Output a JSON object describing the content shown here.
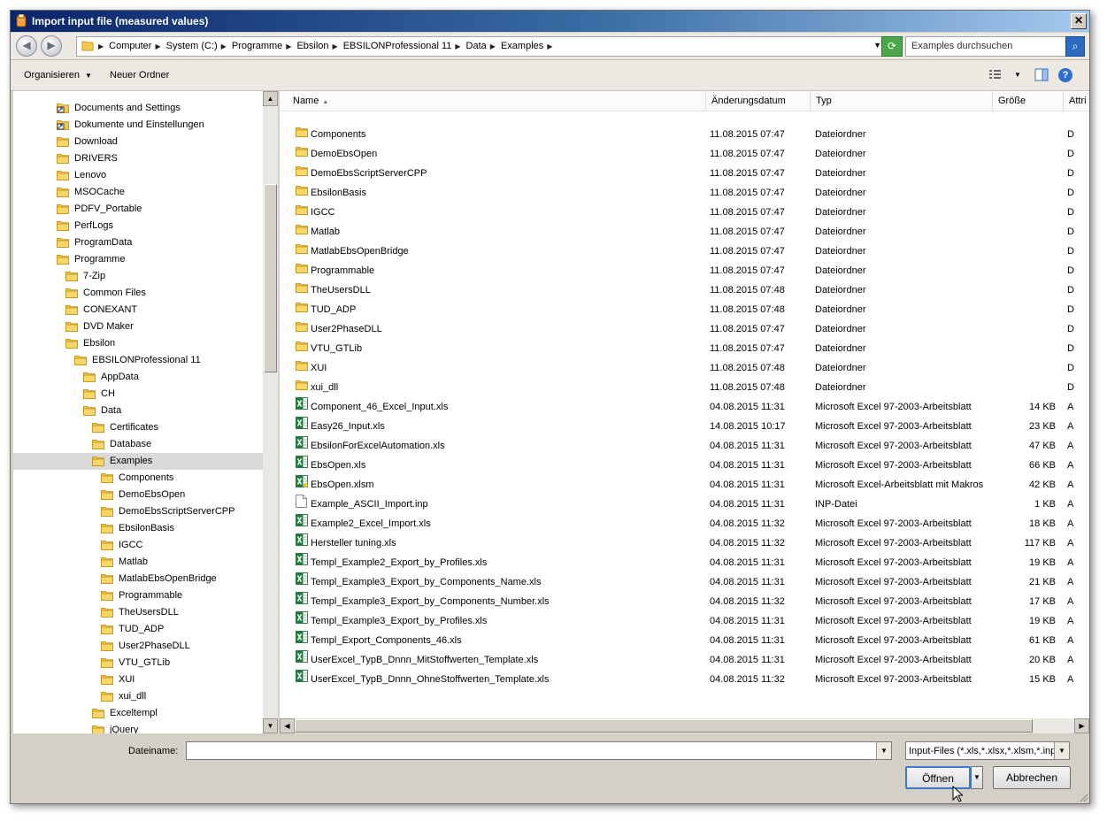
{
  "window": {
    "title": "Import input file (measured values)",
    "close_glyph": "✕"
  },
  "nav": {
    "back_icon": "◀",
    "forward_icon": "▶",
    "breadcrumbs": [
      "Computer",
      "System (C:)",
      "Programme",
      "Ebsilon",
      "EBSILONProfessional 11",
      "Data",
      "Examples"
    ],
    "search_placeholder": "Examples durchsuchen"
  },
  "toolbar": {
    "organize": "Organisieren",
    "new_folder": "Neuer Ordner"
  },
  "tree": [
    {
      "label": "Documents and Settings",
      "level": 0,
      "icon": "shortcut"
    },
    {
      "label": "Dokumente und Einstellungen",
      "level": 0,
      "icon": "shortcut"
    },
    {
      "label": "Download",
      "level": 0,
      "icon": "folder"
    },
    {
      "label": "DRIVERS",
      "level": 0,
      "icon": "folder"
    },
    {
      "label": "Lenovo",
      "level": 0,
      "icon": "folder"
    },
    {
      "label": "MSOCache",
      "level": 0,
      "icon": "folder"
    },
    {
      "label": "PDFV_Portable",
      "level": 0,
      "icon": "folder"
    },
    {
      "label": "PerfLogs",
      "level": 0,
      "icon": "folder"
    },
    {
      "label": "ProgramData",
      "level": 0,
      "icon": "folder"
    },
    {
      "label": "Programme",
      "level": 0,
      "icon": "folder"
    },
    {
      "label": "7-Zip",
      "level": 1,
      "icon": "folder"
    },
    {
      "label": "Common Files",
      "level": 1,
      "icon": "folder"
    },
    {
      "label": "CONEXANT",
      "level": 1,
      "icon": "folder"
    },
    {
      "label": "DVD Maker",
      "level": 1,
      "icon": "folder"
    },
    {
      "label": "Ebsilon",
      "level": 1,
      "icon": "folder"
    },
    {
      "label": "EBSILONProfessional 11",
      "level": 2,
      "icon": "folder"
    },
    {
      "label": "AppData",
      "level": 3,
      "icon": "folder"
    },
    {
      "label": "CH",
      "level": 3,
      "icon": "folder"
    },
    {
      "label": "Data",
      "level": 3,
      "icon": "folder"
    },
    {
      "label": "Certificates",
      "level": 4,
      "icon": "folder"
    },
    {
      "label": "Database",
      "level": 4,
      "icon": "folder"
    },
    {
      "label": "Examples",
      "level": 4,
      "icon": "folder",
      "selected": true
    },
    {
      "label": "Components",
      "level": 5,
      "icon": "folder"
    },
    {
      "label": "DemoEbsOpen",
      "level": 5,
      "icon": "folder"
    },
    {
      "label": "DemoEbsScriptServerCPP",
      "level": 5,
      "icon": "folder"
    },
    {
      "label": "EbsilonBasis",
      "level": 5,
      "icon": "folder"
    },
    {
      "label": "IGCC",
      "level": 5,
      "icon": "folder"
    },
    {
      "label": "Matlab",
      "level": 5,
      "icon": "folder"
    },
    {
      "label": "MatlabEbsOpenBridge",
      "level": 5,
      "icon": "folder"
    },
    {
      "label": "Programmable",
      "level": 5,
      "icon": "folder"
    },
    {
      "label": "TheUsersDLL",
      "level": 5,
      "icon": "folder"
    },
    {
      "label": "TUD_ADP",
      "level": 5,
      "icon": "folder"
    },
    {
      "label": "User2PhaseDLL",
      "level": 5,
      "icon": "folder"
    },
    {
      "label": "VTU_GTLib",
      "level": 5,
      "icon": "folder"
    },
    {
      "label": "XUI",
      "level": 5,
      "icon": "folder"
    },
    {
      "label": "xui_dll",
      "level": 5,
      "icon": "folder"
    },
    {
      "label": "Exceltempl",
      "level": 4,
      "icon": "folder"
    },
    {
      "label": "jQuery",
      "level": 4,
      "icon": "folder"
    }
  ],
  "columns": {
    "name": "Name",
    "date": "Änderungsdatum",
    "type": "Typ",
    "size": "Größe",
    "attr": "Attri"
  },
  "files": [
    {
      "name": "Components",
      "date": "11.08.2015 07:47",
      "type": "Dateiordner",
      "size": "",
      "attr": "D",
      "icon": "folder"
    },
    {
      "name": "DemoEbsOpen",
      "date": "11.08.2015 07:47",
      "type": "Dateiordner",
      "size": "",
      "attr": "D",
      "icon": "folder"
    },
    {
      "name": "DemoEbsScriptServerCPP",
      "date": "11.08.2015 07:47",
      "type": "Dateiordner",
      "size": "",
      "attr": "D",
      "icon": "folder"
    },
    {
      "name": "EbsilonBasis",
      "date": "11.08.2015 07:47",
      "type": "Dateiordner",
      "size": "",
      "attr": "D",
      "icon": "folder"
    },
    {
      "name": "IGCC",
      "date": "11.08.2015 07:47",
      "type": "Dateiordner",
      "size": "",
      "attr": "D",
      "icon": "folder"
    },
    {
      "name": "Matlab",
      "date": "11.08.2015 07:47",
      "type": "Dateiordner",
      "size": "",
      "attr": "D",
      "icon": "folder"
    },
    {
      "name": "MatlabEbsOpenBridge",
      "date": "11.08.2015 07:47",
      "type": "Dateiordner",
      "size": "",
      "attr": "D",
      "icon": "folder"
    },
    {
      "name": "Programmable",
      "date": "11.08.2015 07:47",
      "type": "Dateiordner",
      "size": "",
      "attr": "D",
      "icon": "folder"
    },
    {
      "name": "TheUsersDLL",
      "date": "11.08.2015 07:48",
      "type": "Dateiordner",
      "size": "",
      "attr": "D",
      "icon": "folder"
    },
    {
      "name": "TUD_ADP",
      "date": "11.08.2015 07:48",
      "type": "Dateiordner",
      "size": "",
      "attr": "D",
      "icon": "folder"
    },
    {
      "name": "User2PhaseDLL",
      "date": "11.08.2015 07:47",
      "type": "Dateiordner",
      "size": "",
      "attr": "D",
      "icon": "folder"
    },
    {
      "name": "VTU_GTLib",
      "date": "11.08.2015 07:47",
      "type": "Dateiordner",
      "size": "",
      "attr": "D",
      "icon": "folder"
    },
    {
      "name": "XUI",
      "date": "11.08.2015 07:48",
      "type": "Dateiordner",
      "size": "",
      "attr": "D",
      "icon": "folder"
    },
    {
      "name": "xui_dll",
      "date": "11.08.2015 07:48",
      "type": "Dateiordner",
      "size": "",
      "attr": "D",
      "icon": "folder"
    },
    {
      "name": "Component_46_Excel_Input.xls",
      "date": "04.08.2015 11:31",
      "type": "Microsoft Excel 97-2003-Arbeitsblatt",
      "size": "14 KB",
      "attr": "A",
      "icon": "excel"
    },
    {
      "name": "Easy26_Input.xls",
      "date": "14.08.2015 10:17",
      "type": "Microsoft Excel 97-2003-Arbeitsblatt",
      "size": "23 KB",
      "attr": "A",
      "icon": "excel"
    },
    {
      "name": "EbsilonForExcelAutomation.xls",
      "date": "04.08.2015 11:31",
      "type": "Microsoft Excel 97-2003-Arbeitsblatt",
      "size": "47 KB",
      "attr": "A",
      "icon": "excel"
    },
    {
      "name": "EbsOpen.xls",
      "date": "04.08.2015 11:31",
      "type": "Microsoft Excel 97-2003-Arbeitsblatt",
      "size": "66 KB",
      "attr": "A",
      "icon": "excel"
    },
    {
      "name": "EbsOpen.xlsm",
      "date": "04.08.2015 11:31",
      "type": "Microsoft Excel-Arbeitsblatt mit Makros",
      "size": "42 KB",
      "attr": "A",
      "icon": "excel-macro"
    },
    {
      "name": "Example_ASCII_Import.inp",
      "date": "04.08.2015 11:31",
      "type": "INP-Datei",
      "size": "1 KB",
      "attr": "A",
      "icon": "blank"
    },
    {
      "name": "Example2_Excel_Import.xls",
      "date": "04.08.2015 11:32",
      "type": "Microsoft Excel 97-2003-Arbeitsblatt",
      "size": "18 KB",
      "attr": "A",
      "icon": "excel"
    },
    {
      "name": "Hersteller tuning.xls",
      "date": "04.08.2015 11:32",
      "type": "Microsoft Excel 97-2003-Arbeitsblatt",
      "size": "117 KB",
      "attr": "A",
      "icon": "excel"
    },
    {
      "name": "Templ_Example2_Export_by_Profiles.xls",
      "date": "04.08.2015 11:31",
      "type": "Microsoft Excel 97-2003-Arbeitsblatt",
      "size": "19 KB",
      "attr": "A",
      "icon": "excel"
    },
    {
      "name": "Templ_Example3_Export_by_Components_Name.xls",
      "date": "04.08.2015 11:31",
      "type": "Microsoft Excel 97-2003-Arbeitsblatt",
      "size": "21 KB",
      "attr": "A",
      "icon": "excel"
    },
    {
      "name": "Templ_Example3_Export_by_Components_Number.xls",
      "date": "04.08.2015 11:32",
      "type": "Microsoft Excel 97-2003-Arbeitsblatt",
      "size": "17 KB",
      "attr": "A",
      "icon": "excel"
    },
    {
      "name": "Templ_Example3_Export_by_Profiles.xls",
      "date": "04.08.2015 11:31",
      "type": "Microsoft Excel 97-2003-Arbeitsblatt",
      "size": "19 KB",
      "attr": "A",
      "icon": "excel"
    },
    {
      "name": "Templ_Export_Components_46.xls",
      "date": "04.08.2015 11:31",
      "type": "Microsoft Excel 97-2003-Arbeitsblatt",
      "size": "61 KB",
      "attr": "A",
      "icon": "excel"
    },
    {
      "name": "UserExcel_TypB_Dnnn_MitStoffwerten_Template.xls",
      "date": "04.08.2015 11:31",
      "type": "Microsoft Excel 97-2003-Arbeitsblatt",
      "size": "20 KB",
      "attr": "A",
      "icon": "excel"
    },
    {
      "name": "UserExcel_TypB_Dnnn_OhneStoffwerten_Template.xls",
      "date": "04.08.2015 11:32",
      "type": "Microsoft Excel 97-2003-Arbeitsblatt",
      "size": "15 KB",
      "attr": "A",
      "icon": "excel"
    }
  ],
  "bottom": {
    "filename_label": "Dateiname:",
    "filename_value": "",
    "filetype": "Input-Files (*.xls,*.xlsx,*.xlsm,*.inp)",
    "open_label": "Öffnen",
    "cancel_label": "Abbrechen"
  },
  "colors": {
    "folder": "#f3c84b",
    "folder_dark": "#c89a22",
    "excel": "#1f7a3c",
    "selection": "#d9d9d9"
  }
}
